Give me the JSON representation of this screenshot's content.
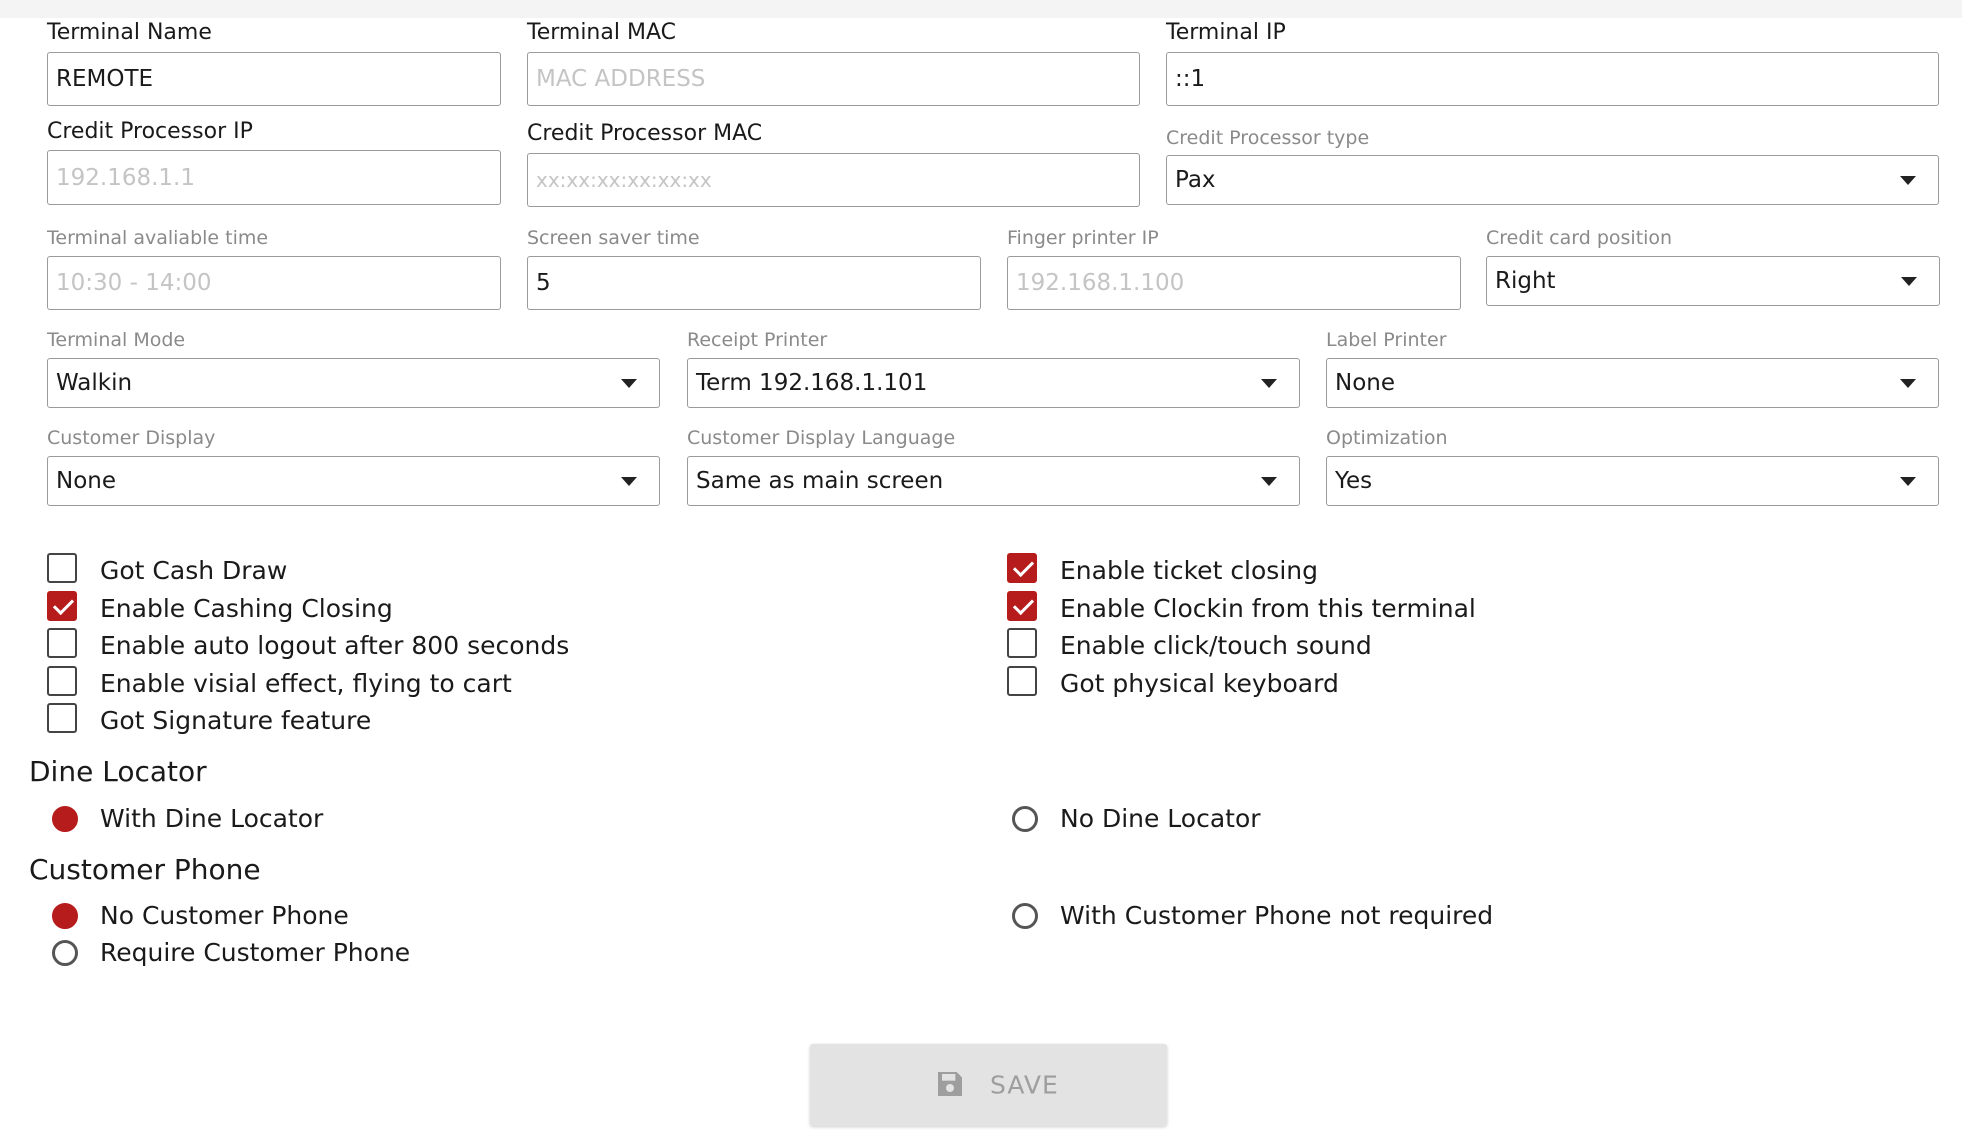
{
  "fields": {
    "terminal_name": {
      "label": "Terminal Name",
      "value": "REMOTE"
    },
    "terminal_mac": {
      "label": "Terminal MAC",
      "placeholder": "MAC ADDRESS"
    },
    "terminal_ip": {
      "label": "Terminal IP",
      "value": "::1"
    },
    "credit_processor_ip": {
      "label": "Credit Processor IP",
      "placeholder": "192.168.1.1"
    },
    "credit_processor_mac": {
      "label": "Credit Processor MAC",
      "placeholder": "xx:xx:xx:xx:xx:xx"
    },
    "credit_processor_type": {
      "label": "Credit Processor type",
      "value": "Pax"
    },
    "terminal_available_time": {
      "label": "Terminal avaliable time",
      "placeholder": "10:30 - 14:00"
    },
    "screen_saver_time": {
      "label": "Screen saver time",
      "value": "5"
    },
    "finger_printer_ip": {
      "label": "Finger printer IP",
      "placeholder": "192.168.1.100"
    },
    "credit_card_position": {
      "label": "Credit card position",
      "value": "Right"
    },
    "terminal_mode": {
      "label": "Terminal Mode",
      "value": "Walkin"
    },
    "receipt_printer": {
      "label": "Receipt Printer",
      "value": "Term 192.168.1.101"
    },
    "label_printer": {
      "label": "Label Printer",
      "value": "None"
    },
    "customer_display": {
      "label": "Customer Display",
      "value": "None"
    },
    "customer_display_language": {
      "label": "Customer Display Language",
      "value": "Same as main screen"
    },
    "optimization": {
      "label": "Optimization",
      "value": "Yes"
    }
  },
  "checkboxes": [
    {
      "label": "Got Cash Draw",
      "checked": false
    },
    {
      "label": "Enable Cashing Closing",
      "checked": true
    },
    {
      "label": "Enable auto logout after 800 seconds",
      "checked": false
    },
    {
      "label": "Enable visial effect, flying to cart",
      "checked": false
    },
    {
      "label": "Got Signature feature",
      "checked": false
    },
    {
      "label": "Enable ticket closing",
      "checked": true
    },
    {
      "label": "Enable Clockin from this terminal",
      "checked": true
    },
    {
      "label": "Enable click/touch sound",
      "checked": false
    },
    {
      "label": "Got physical keyboard",
      "checked": false
    }
  ],
  "dine_locator": {
    "title": "Dine Locator",
    "options": [
      {
        "label": "With Dine Locator",
        "selected": true
      },
      {
        "label": "No Dine Locator",
        "selected": false
      }
    ]
  },
  "customer_phone": {
    "title": "Customer Phone",
    "options": [
      {
        "label": "No Customer Phone",
        "selected": true
      },
      {
        "label": "With Customer Phone not required",
        "selected": false
      },
      {
        "label": "Require Customer Phone",
        "selected": false
      }
    ]
  },
  "save_button": {
    "label": "SAVE",
    "icon": "floppy-disk-icon"
  },
  "colors": {
    "accent": "#b71c1c",
    "border": "#9a9a9a",
    "placeholder": "#c4c4c4",
    "muted_label": "#8a8a8a"
  }
}
